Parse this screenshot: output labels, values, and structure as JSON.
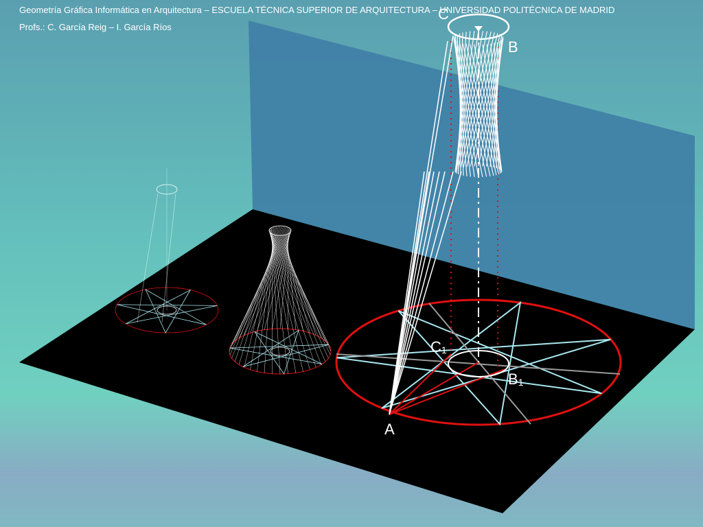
{
  "header": {
    "title": "Geometría Gráfica Informática en Arquitectura – ESCUELA TÉCNICA SUPERIOR DE ARQUITECTURA – UNIVERSIDAD POLITÉCNICA DE MADRID",
    "authors": "Profs.: C. García Reig – I. García Ríos"
  },
  "labels": {
    "a": "A",
    "b": "B",
    "c": "C",
    "b1": "B",
    "b1_sub": "1",
    "c1": "C",
    "c1_sub": "1"
  },
  "colors": {
    "ground": "#000000",
    "wall": "#3f7ea6",
    "circle": "#e01010",
    "star": "#a8e8f0",
    "ruled_lines": "#ffffff",
    "axis": "#ffffff",
    "projection_dots": "#e01010"
  },
  "star_points": 7
}
